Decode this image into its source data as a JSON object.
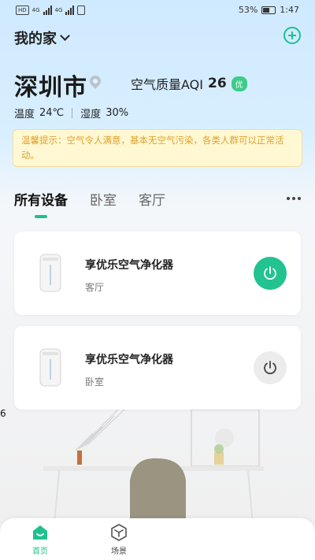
{
  "status_bar": {
    "battery_percent": "53%",
    "time": "1:47",
    "network_a": "4G",
    "network_b": "4G"
  },
  "header": {
    "home_name": "我的家"
  },
  "location": {
    "city": "深圳市",
    "aqi_label": "空气质量AQI",
    "aqi_value": "26",
    "aqi_level": "优"
  },
  "weather": {
    "temp_label": "温度",
    "temp_value": "24℃",
    "humidity_label": "湿度",
    "humidity_value": "30%"
  },
  "tip": {
    "text": "温馨提示：空气令人满意，基本无空气污染，各类人群可以正常活动。"
  },
  "tabs": [
    {
      "label": "所有设备",
      "active": true
    },
    {
      "label": "卧室",
      "active": false
    },
    {
      "label": "客厅",
      "active": false
    }
  ],
  "devices": [
    {
      "name": "享优乐空气净化器",
      "room": "客厅",
      "power": "on"
    },
    {
      "name": "享优乐空气净化器",
      "room": "卧室",
      "power": "off"
    }
  ],
  "side_label": "6",
  "bottom_nav": {
    "items": [
      {
        "label": "首页",
        "icon": "home-icon",
        "active": true
      },
      {
        "label": "场景",
        "icon": "scene-cube-icon",
        "active": false
      }
    ]
  },
  "colors": {
    "accent": "#1fc08e",
    "tip_text": "#e0a12c",
    "tip_bg": "#fff8d2"
  }
}
